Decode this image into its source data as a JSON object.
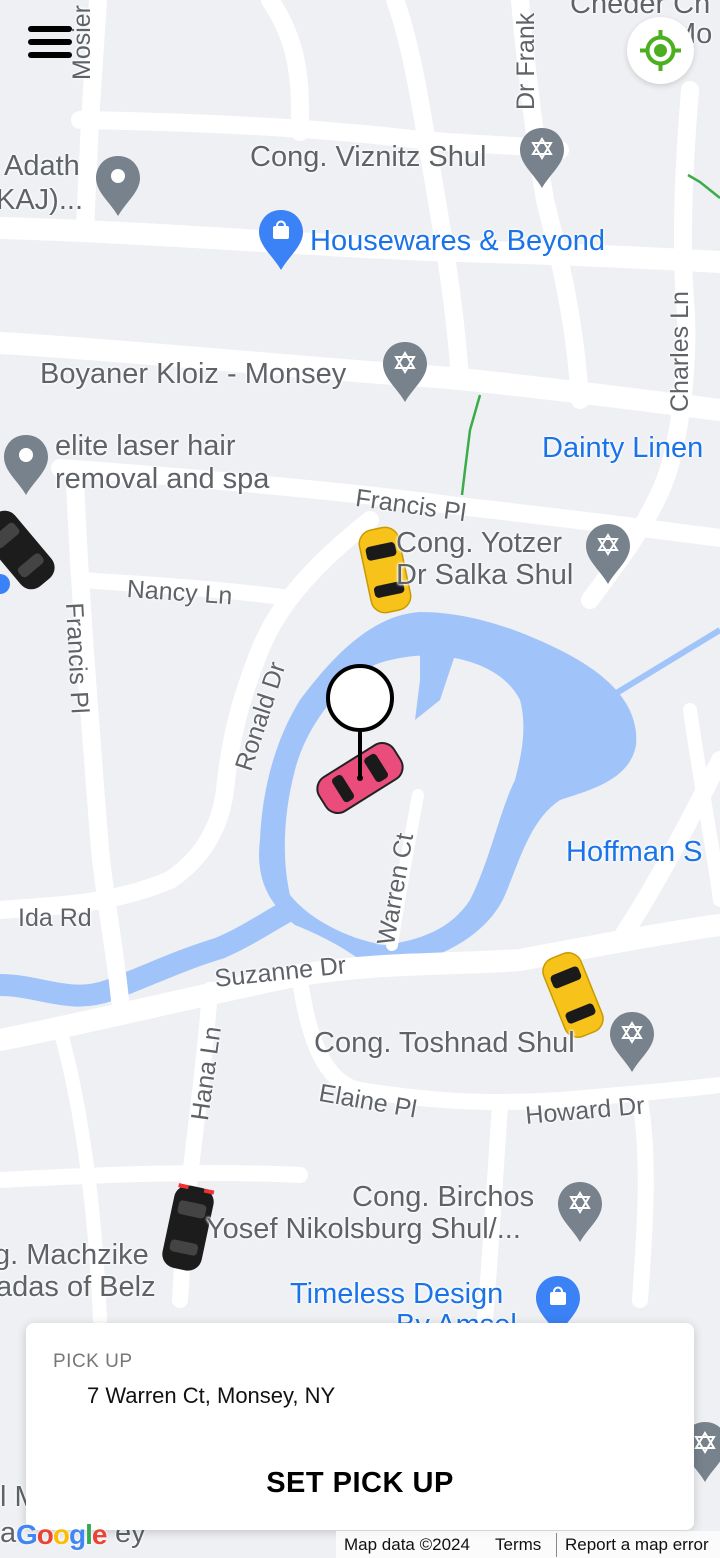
{
  "map": {
    "labels": {
      "mosier": "Mosier",
      "dr_frank": "Dr Frank",
      "cheder_top": "Cheder Ch",
      "mo_top": "Mo",
      "adath": "Adath",
      "kaj": "KAJ)...",
      "viznitz": "Cong. Viznitz Shul",
      "housewares": "Housewares & Beyond",
      "charles": "Charles Ln",
      "boyaner": "Boyaner Kloiz - Monsey",
      "elite1": "elite laser hair",
      "elite2": "removal and spa",
      "dainty": "Dainty Linen",
      "francis_pl": "Francis Pl",
      "yotzer1": "Cong. Yotzer",
      "yotzer2": "Dr Salka Shul",
      "nancy": "Nancy Ln",
      "francis_pl_vert": "Francis Pl",
      "ronald": "Ronald Dr",
      "warren": "Warren Ct",
      "hoffman": "Hoffman S",
      "ida": "Ida Rd",
      "suzanne": "Suzanne Dr",
      "toshnad": "Cong. Toshnad Shul",
      "hana": "Hana Ln",
      "elaine": "Elaine Pl",
      "howard": "Howard Dr",
      "birchos1": "Cong. Birchos",
      "birchos2": "Yosef Nikolsburg Shul/...",
      "machzike1": "g. Machzike",
      "machzike2": "adas of Belz",
      "timeless1": "Timeless Design",
      "timeless2": "By Amsel",
      "left_m": "l M",
      "left_a": "a",
      "ey": "ey"
    }
  },
  "pickup": {
    "label": "PICK UP",
    "address": "7 Warren Ct, Monsey, NY",
    "button_label": "SET PICK UP"
  },
  "footer": {
    "logo_letters": [
      "G",
      "o",
      "o",
      "g",
      "l",
      "e"
    ],
    "map_data": "Map data ©2024",
    "terms": "Terms",
    "report": "Report a map error"
  },
  "colors": {
    "map_background": "#eef0f3",
    "road": "#ffffff",
    "water": "#a0c4fa",
    "poi_gray": "#78828c",
    "poi_blue": "#3b82f6",
    "label_gray": "#5f6368",
    "label_blue": "#1a73e8",
    "taxi_yellow": "#f7c21a",
    "car_black": "#1c1c1c",
    "car_pink": "#ea4c7c",
    "locate_green": "#4caf1f"
  },
  "icons": {
    "menu": "hamburger-menu-icon",
    "locate": "crosshair-location-icon",
    "pickup_pin": "map-pin-icon",
    "poi_place": "place-pin-icon",
    "poi_worship": "star-of-david-pin-icon",
    "poi_shopping": "shopping-bag-pin-icon"
  }
}
